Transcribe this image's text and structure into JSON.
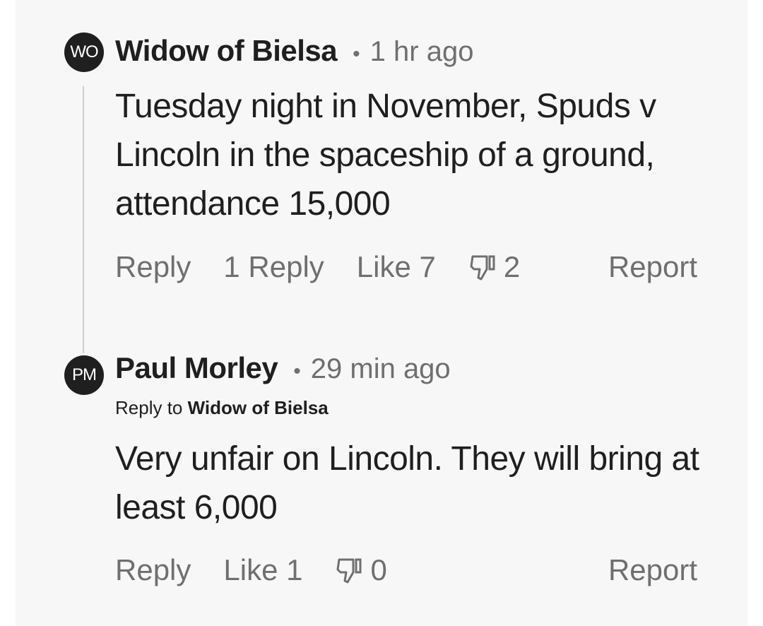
{
  "comments": [
    {
      "avatar_initials": "WO",
      "author": "Widow of Bielsa",
      "separator": "•",
      "time": "1 hr ago",
      "text": "Tuesday night in November, Spuds v Lincoln in the spaceship of a ground, attendance 15,000",
      "actions": {
        "reply": "Reply",
        "replies": "1 Reply",
        "like": "Like 7",
        "dislike_icon": "thumbs-down-icon",
        "dislike_count": "2",
        "report": "Report"
      }
    },
    {
      "avatar_initials": "PM",
      "author": "Paul Morley",
      "separator": "•",
      "time": "29 min ago",
      "reply_to_prefix": "Reply to",
      "reply_to_author": "Widow of Bielsa",
      "text": "Very unfair on Lincoln. They will bring at least 6,000",
      "actions": {
        "reply": "Reply",
        "like": "Like 1",
        "dislike_icon": "thumbs-down-icon",
        "dislike_count": "0",
        "report": "Report"
      }
    }
  ],
  "colors": {
    "panel_bg": "#f7f7f7",
    "text_primary": "#1f1f1f",
    "text_secondary": "#6f6f6f",
    "avatar_bg": "#1f1f1f"
  }
}
